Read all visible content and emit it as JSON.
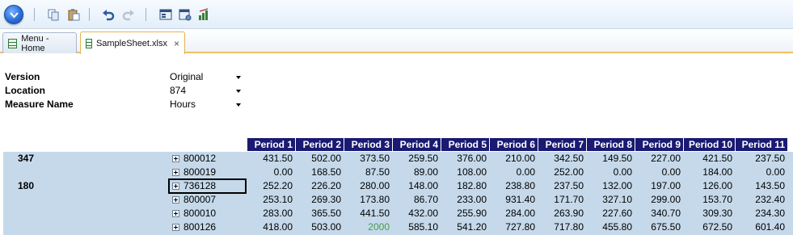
{
  "toolbar": {
    "buttons": [
      "app-menu",
      "copy",
      "paste",
      "undo",
      "redo",
      "view-a",
      "view-b",
      "view-c"
    ]
  },
  "tabs": [
    {
      "label": "Menu - Home",
      "active": false
    },
    {
      "label": "SampleSheet.xlsx",
      "active": true,
      "close": "×"
    }
  ],
  "filters": [
    {
      "label": "Version",
      "value": "Original"
    },
    {
      "label": "Location",
      "value": "874"
    },
    {
      "label": "Measure Name",
      "value": "Hours"
    }
  ],
  "grid": {
    "columns": [
      "Period 1",
      "Period 2",
      "Period 3",
      "Period 4",
      "Period 5",
      "Period 6",
      "Period 7",
      "Period 8",
      "Period 9",
      "Period 10",
      "Period 11"
    ],
    "rows": [
      {
        "key": "347",
        "code": "800012",
        "values": [
          "431.50",
          "502.00",
          "373.50",
          "259.50",
          "376.00",
          "210.00",
          "342.50",
          "149.50",
          "227.00",
          "421.50",
          "237.50"
        ]
      },
      {
        "key": "",
        "code": "800019",
        "values": [
          "0.00",
          "168.50",
          "87.50",
          "89.00",
          "108.00",
          "0.00",
          "252.00",
          "0.00",
          "0.00",
          "184.00",
          "0.00"
        ]
      },
      {
        "key": "180",
        "code": "736128",
        "values": [
          "252.20",
          "226.20",
          "280.00",
          "148.00",
          "182.80",
          "238.80",
          "237.50",
          "132.00",
          "197.00",
          "126.00",
          "143.50"
        ],
        "selected": true
      },
      {
        "key": "",
        "code": "800007",
        "values": [
          "253.10",
          "269.30",
          "173.80",
          "86.70",
          "233.00",
          "931.40",
          "171.70",
          "327.10",
          "299.00",
          "153.70",
          "232.40"
        ]
      },
      {
        "key": "",
        "code": "800010",
        "values": [
          "283.00",
          "365.50",
          "441.50",
          "432.00",
          "255.90",
          "284.00",
          "263.90",
          "227.60",
          "340.70",
          "309.30",
          "234.30"
        ]
      },
      {
        "key": "",
        "code": "800126",
        "values": [
          "418.00",
          "503.00",
          "2000",
          "585.10",
          "541.20",
          "727.80",
          "717.80",
          "455.80",
          "675.50",
          "672.50",
          "601.40"
        ],
        "highlight_index": 2
      }
    ]
  },
  "colors": {
    "header_bg": "#1a1a73",
    "row_bg": "#c5d9ea",
    "tab_accent": "#f0c060",
    "edited_value": "#4a9a4a"
  }
}
